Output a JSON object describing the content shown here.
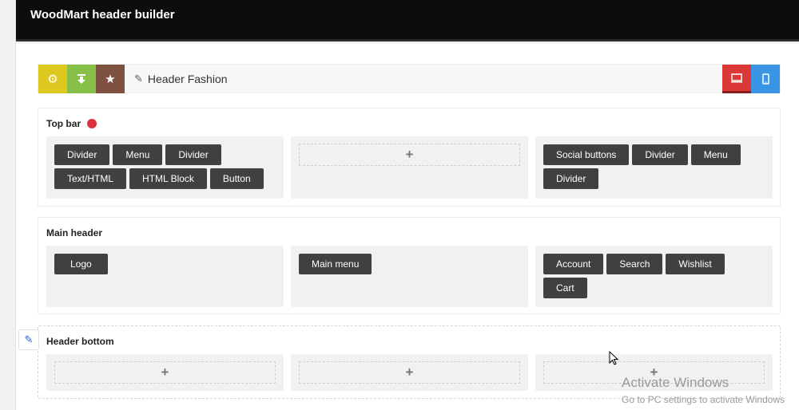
{
  "app": {
    "title": "WoodMart header builder"
  },
  "toolbar": {
    "settings_icon": "gear-icon",
    "import_icon": "download-icon",
    "star_icon": "star-icon",
    "header_name": "Header Fashion",
    "desktop_icon": "desktop-icon",
    "mobile_icon": "mobile-icon",
    "colors": {
      "settings": "#dcc81f",
      "import": "#86c048",
      "star": "#7d5040",
      "desktop": "#dc3838",
      "mobile": "#3a96e4"
    }
  },
  "rows": {
    "top_bar": {
      "title": "Top bar",
      "left": [
        "Divider",
        "Menu",
        "Divider",
        "Text/HTML",
        "HTML Block",
        "Button"
      ],
      "middle_plus": "+",
      "right": [
        "Social buttons",
        "Divider",
        "Menu",
        "Divider"
      ]
    },
    "main_header": {
      "title": "Main header",
      "left": [
        "Logo"
      ],
      "middle": [
        "Main menu"
      ],
      "right": [
        "Account",
        "Search",
        "Wishlist",
        "Cart"
      ]
    },
    "header_bottom": {
      "title": "Header bottom",
      "left_plus": "+",
      "middle_plus": "+",
      "right_plus": "+"
    }
  },
  "watermark": {
    "title": "Activate Windows",
    "subtitle": "Go to PC settings to activate Windows"
  }
}
